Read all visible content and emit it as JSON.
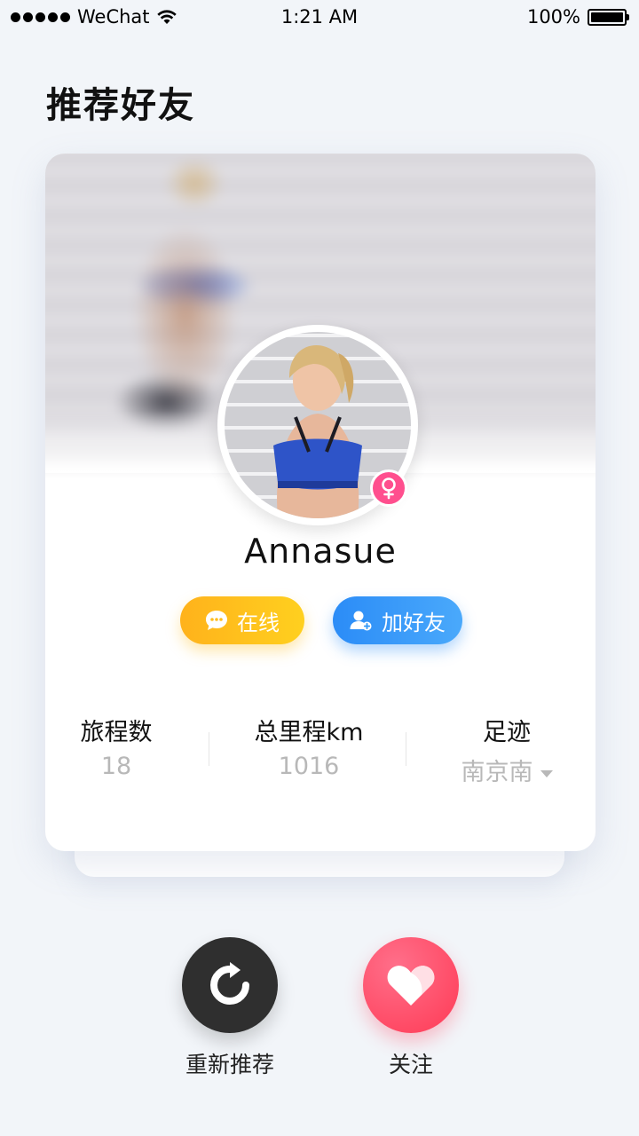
{
  "status_bar": {
    "carrier": "WeChat",
    "time": "1:21 AM",
    "battery": "100%"
  },
  "page": {
    "title": "推荐好友"
  },
  "profile": {
    "username": "Annasue",
    "gender_icon": "female-icon",
    "online_label": "在线",
    "add_friend_label": "加好友",
    "stats": {
      "trips_label": "旅程数",
      "trips_value": "18",
      "mileage_label": "总里程km",
      "mileage_value": "1016",
      "footprint_label": "足迹",
      "footprint_value": "南京南"
    }
  },
  "actions": {
    "refresh_label": "重新推荐",
    "follow_label": "关注"
  },
  "colors": {
    "online_pill": "#ffc01e",
    "add_pill": "#3399f8",
    "gender_badge": "#ff4f8e",
    "follow_button": "#ff4560",
    "refresh_button": "#2f2f2f"
  }
}
